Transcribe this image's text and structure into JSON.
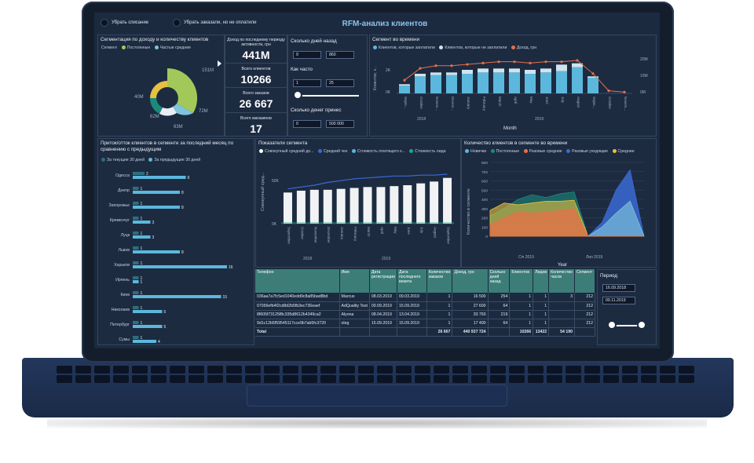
{
  "toolbar": {
    "btn_remove_writeoff": "Убрать списание",
    "btn_remove_unpaid": "Убрать заказали, но не оплатили",
    "title": "RFM-анализ клиентов"
  },
  "segmentation": {
    "title": "Сегментация по доходу и количеству клиентов",
    "legend_label": "Сегмент",
    "legend": [
      "Постоянные",
      "Частые средние"
    ],
    "labels": [
      "151M",
      "40M",
      "72M",
      "62M",
      "63M"
    ]
  },
  "kpis": [
    {
      "label": "Доход по последнему периоду активности, грн",
      "value": "441M"
    },
    {
      "label": "Всего клиентов",
      "value": "10266"
    },
    {
      "label": "Всего заказов",
      "value": "26 667"
    },
    {
      "label": "Всего магазинов",
      "value": "17"
    }
  ],
  "filters": {
    "days_ago_label": "Сколько дней назад",
    "days_from": "9",
    "days_to": "860",
    "how_often_label": "Как часто",
    "often_from": "1",
    "often_to": "25",
    "money_label": "Сколько денег принес",
    "money_from": "0",
    "money_to": "500 000"
  },
  "segment_time": {
    "title": "Сегмент во времени",
    "legend": [
      "Клиентов, которые заплатили",
      "Клиентов, которые не заплатили",
      "Доход, грн"
    ],
    "ylabel": "Клиентов, к...",
    "yticks_left": [
      "2K",
      "0K"
    ],
    "yticks_right": [
      "20M",
      "10M",
      "0M"
    ],
    "months": [
      "Septe...",
      "October",
      "Novem...",
      "Decem...",
      "January",
      "February",
      "March",
      "April",
      "May",
      "June",
      "July",
      "August",
      "Septe...",
      "October",
      "Novem..."
    ],
    "years": [
      "2018",
      "2019"
    ],
    "xlabel": "Month"
  },
  "inflow": {
    "title": "Приток/отток клиентов в сегменте за последний месяц по сравнению с предыдущим",
    "legend": [
      "За текущие 30 дней",
      "За предыдущие 30 дней"
    ]
  },
  "segment_indicators": {
    "title": "Показатели сегмента",
    "legend": [
      "Совокупный средний до...",
      "Средний чек",
      "Стоимость платящего к...",
      "Стоимость лида"
    ],
    "ylabel": "Совокупный сред...",
    "yticks": [
      "50K",
      "0K"
    ],
    "months": [
      "September",
      "October",
      "November",
      "December",
      "January",
      "February",
      "March",
      "April",
      "May",
      "June",
      "July",
      "August",
      "September"
    ],
    "years": [
      "2018",
      "2019"
    ]
  },
  "clients_time": {
    "title": "Количество клиентов в сегменте во времени",
    "legend": [
      "Новички",
      "Постоянные",
      "Разовые средние",
      "Разовые уходящие",
      "Средние"
    ],
    "ylabel": "Количество в сегменте",
    "yticks": [
      "800",
      "700",
      "600",
      "500",
      "400",
      "300",
      "200",
      "100",
      "0"
    ],
    "xticks": [
      "Січ 2019",
      "Лип 2019"
    ],
    "xlabel": "Year"
  },
  "table": {
    "headers": [
      "Телефон",
      "Имя",
      "Дата регистрации",
      "Дата последнего визита",
      "Количество заказов",
      "Доход, грн",
      "Сколько дней назад",
      "Клиентов",
      "Лидов",
      "Количество часов",
      "Сегмент"
    ],
    "rows": [
      [
        "036aa7a7fc5ed1040edd9c8a85bad8bd",
        "Marcus",
        "08.03.2019",
        "09.03.2019",
        "1",
        "16 500",
        "254",
        "1",
        "1",
        "3",
        "212"
      ],
      [
        "07056efb4f2cd8d2b5fb3ec736eaef",
        "AdQuality Test",
        "09.09.2019",
        "15.09.2019",
        "1",
        "27 600",
        "64",
        "1",
        "1",
        "",
        "212"
      ],
      [
        "8f605f73125f8c335d8612b4349ca2",
        "Alyona",
        "08.04.2019",
        "13.04.2019",
        "1",
        "33 750",
        "219",
        "1",
        "1",
        "",
        "212"
      ],
      [
        "9d1c12b5f59545117cce9b7ab5fc3720",
        "oleg",
        "15.09.2019",
        "15.09.2019",
        "1",
        "17 400",
        "64",
        "1",
        "1",
        "",
        "212"
      ]
    ],
    "total": [
      "Total",
      "",
      "",
      "",
      "26 667",
      "440 937 724",
      "",
      "10266",
      "13422",
      "54 190",
      ""
    ]
  },
  "period": {
    "label": "Период",
    "from": "16.09.2018",
    "to": "09.11.2019"
  },
  "chart_data": [
    {
      "type": "bar",
      "name_ref": "inflow",
      "categories": [
        "Одесса",
        "Днепр",
        "Запорожье",
        "Кременчуг",
        "Луцк",
        "Львов",
        "Харьков",
        "Ирпень",
        "Киев",
        "Николаев",
        "Петербург",
        "Сумы"
      ],
      "series": [
        {
          "name": "За текущие 30 дней",
          "values": [
            2,
            1,
            1,
            1,
            1,
            1,
            1,
            1,
            1,
            1,
            1,
            1
          ]
        },
        {
          "name": "За предыдущие 30 дней",
          "values": [
            9,
            8,
            8,
            3,
            3,
            8,
            16,
            1,
            15,
            5,
            5,
            4
          ]
        }
      ],
      "data_labels": [
        "2",
        "9",
        "1",
        "8",
        "1",
        "8",
        "1",
        "3",
        "1",
        "3",
        "1",
        "8",
        "1",
        "16",
        "1",
        "1",
        "15",
        "5",
        "5",
        "4"
      ]
    },
    {
      "type": "bar",
      "name_ref": "segment_time",
      "categories": [
        "Sep 2018",
        "Oct 2018",
        "Nov 2018",
        "Dec 2018",
        "Jan 2019",
        "Feb 2019",
        "Mar 2019",
        "Apr 2019",
        "May 2019",
        "Jun 2019",
        "Jul 2019",
        "Aug 2019",
        "Sep 2019",
        "Oct 2019",
        "Nov 2019"
      ],
      "series": [
        {
          "name": "Клиентов, которые заплатили",
          "values": [
            600,
            1300,
            1400,
            1400,
            1500,
            1600,
            1600,
            1600,
            1500,
            1600,
            1700,
            2000,
            1200,
            0,
            0
          ]
        },
        {
          "name": "Клиентов, которые не заплатили",
          "values": [
            100,
            200,
            200,
            200,
            300,
            300,
            300,
            300,
            300,
            300,
            500,
            300,
            100,
            0,
            0
          ]
        },
        {
          "name": "Доход, грн",
          "values": [
            10,
            19,
            21,
            21,
            22,
            23,
            24,
            24,
            23,
            24,
            24,
            25,
            15,
            2,
            1
          ]
        }
      ]
    },
    {
      "type": "bar",
      "name_ref": "segment_indicators",
      "categories": [
        "Sep 2018",
        "Oct 2018",
        "Nov 2018",
        "Dec 2018",
        "Jan 2019",
        "Feb 2019",
        "Mar 2019",
        "Apr 2019",
        "May 2019",
        "Jun 2019",
        "Jul 2019",
        "Aug 2019",
        "Sep 2019"
      ],
      "series": [
        {
          "name": "Совокупный средний до...",
          "values": [
            34,
            36,
            37,
            37,
            38,
            39,
            40,
            40,
            41,
            42,
            44,
            46,
            50
          ]
        },
        {
          "name": "Средний чек",
          "values": [
            38,
            40,
            42,
            45,
            47,
            49,
            50,
            51,
            52,
            52,
            53,
            53,
            54
          ]
        }
      ],
      "ylim": [
        0,
        60
      ]
    },
    {
      "type": "area",
      "name_ref": "clients_time",
      "x": [
        "Oct 2018",
        "Nov 2018",
        "Dec 2018",
        "Jan 2019",
        "Feb 2019",
        "Mar 2019",
        "Apr 2019",
        "May 2019",
        "Jun 2019",
        "Jul 2019",
        "Aug 2019",
        "Sep 2019"
      ],
      "series": [
        {
          "name": "Новички",
          "values": [
            0,
            0,
            0,
            0,
            0,
            0,
            0,
            0,
            150,
            500,
            720,
            0
          ]
        },
        {
          "name": "Постоянные",
          "values": [
            220,
            300,
            400,
            450,
            420,
            460,
            480,
            0,
            0,
            0,
            0,
            0
          ]
        },
        {
          "name": "Разовые средние",
          "values": [
            120,
            200,
            260,
            250,
            260,
            280,
            300,
            0,
            0,
            0,
            0,
            0
          ]
        },
        {
          "name": "Разовые уходящие",
          "values": [
            0,
            0,
            0,
            0,
            0,
            0,
            0,
            0,
            100,
            250,
            380,
            0
          ]
        },
        {
          "name": "Средние",
          "values": [
            280,
            360,
            340,
            360,
            380,
            380,
            390,
            0,
            0,
            0,
            0,
            0
          ]
        }
      ],
      "ylim": [
        0,
        800
      ]
    }
  ]
}
